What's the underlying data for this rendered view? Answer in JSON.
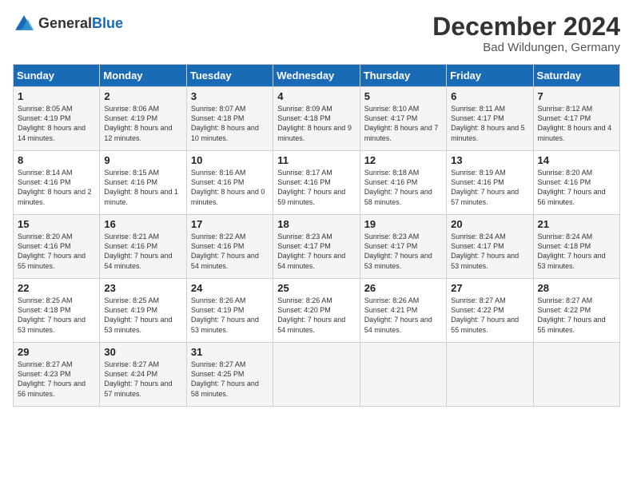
{
  "logo": {
    "general": "General",
    "blue": "Blue"
  },
  "title": "December 2024",
  "subtitle": "Bad Wildungen, Germany",
  "headers": [
    "Sunday",
    "Monday",
    "Tuesday",
    "Wednesday",
    "Thursday",
    "Friday",
    "Saturday"
  ],
  "weeks": [
    [
      {
        "day": "1",
        "sunrise": "8:05 AM",
        "sunset": "4:19 PM",
        "daylight": "8 hours and 14 minutes."
      },
      {
        "day": "2",
        "sunrise": "8:06 AM",
        "sunset": "4:19 PM",
        "daylight": "8 hours and 12 minutes."
      },
      {
        "day": "3",
        "sunrise": "8:07 AM",
        "sunset": "4:18 PM",
        "daylight": "8 hours and 10 minutes."
      },
      {
        "day": "4",
        "sunrise": "8:09 AM",
        "sunset": "4:18 PM",
        "daylight": "8 hours and 9 minutes."
      },
      {
        "day": "5",
        "sunrise": "8:10 AM",
        "sunset": "4:17 PM",
        "daylight": "8 hours and 7 minutes."
      },
      {
        "day": "6",
        "sunrise": "8:11 AM",
        "sunset": "4:17 PM",
        "daylight": "8 hours and 5 minutes."
      },
      {
        "day": "7",
        "sunrise": "8:12 AM",
        "sunset": "4:17 PM",
        "daylight": "8 hours and 4 minutes."
      }
    ],
    [
      {
        "day": "8",
        "sunrise": "8:14 AM",
        "sunset": "4:16 PM",
        "daylight": "8 hours and 2 minutes."
      },
      {
        "day": "9",
        "sunrise": "8:15 AM",
        "sunset": "4:16 PM",
        "daylight": "8 hours and 1 minute."
      },
      {
        "day": "10",
        "sunrise": "8:16 AM",
        "sunset": "4:16 PM",
        "daylight": "8 hours and 0 minutes."
      },
      {
        "day": "11",
        "sunrise": "8:17 AM",
        "sunset": "4:16 PM",
        "daylight": "7 hours and 59 minutes."
      },
      {
        "day": "12",
        "sunrise": "8:18 AM",
        "sunset": "4:16 PM",
        "daylight": "7 hours and 58 minutes."
      },
      {
        "day": "13",
        "sunrise": "8:19 AM",
        "sunset": "4:16 PM",
        "daylight": "7 hours and 57 minutes."
      },
      {
        "day": "14",
        "sunrise": "8:20 AM",
        "sunset": "4:16 PM",
        "daylight": "7 hours and 56 minutes."
      }
    ],
    [
      {
        "day": "15",
        "sunrise": "8:20 AM",
        "sunset": "4:16 PM",
        "daylight": "7 hours and 55 minutes."
      },
      {
        "day": "16",
        "sunrise": "8:21 AM",
        "sunset": "4:16 PM",
        "daylight": "7 hours and 54 minutes."
      },
      {
        "day": "17",
        "sunrise": "8:22 AM",
        "sunset": "4:16 PM",
        "daylight": "7 hours and 54 minutes."
      },
      {
        "day": "18",
        "sunrise": "8:23 AM",
        "sunset": "4:17 PM",
        "daylight": "7 hours and 54 minutes."
      },
      {
        "day": "19",
        "sunrise": "8:23 AM",
        "sunset": "4:17 PM",
        "daylight": "7 hours and 53 minutes."
      },
      {
        "day": "20",
        "sunrise": "8:24 AM",
        "sunset": "4:17 PM",
        "daylight": "7 hours and 53 minutes."
      },
      {
        "day": "21",
        "sunrise": "8:24 AM",
        "sunset": "4:18 PM",
        "daylight": "7 hours and 53 minutes."
      }
    ],
    [
      {
        "day": "22",
        "sunrise": "8:25 AM",
        "sunset": "4:18 PM",
        "daylight": "7 hours and 53 minutes."
      },
      {
        "day": "23",
        "sunrise": "8:25 AM",
        "sunset": "4:19 PM",
        "daylight": "7 hours and 53 minutes."
      },
      {
        "day": "24",
        "sunrise": "8:26 AM",
        "sunset": "4:19 PM",
        "daylight": "7 hours and 53 minutes."
      },
      {
        "day": "25",
        "sunrise": "8:26 AM",
        "sunset": "4:20 PM",
        "daylight": "7 hours and 54 minutes."
      },
      {
        "day": "26",
        "sunrise": "8:26 AM",
        "sunset": "4:21 PM",
        "daylight": "7 hours and 54 minutes."
      },
      {
        "day": "27",
        "sunrise": "8:27 AM",
        "sunset": "4:22 PM",
        "daylight": "7 hours and 55 minutes."
      },
      {
        "day": "28",
        "sunrise": "8:27 AM",
        "sunset": "4:22 PM",
        "daylight": "7 hours and 55 minutes."
      }
    ],
    [
      {
        "day": "29",
        "sunrise": "8:27 AM",
        "sunset": "4:23 PM",
        "daylight": "7 hours and 56 minutes."
      },
      {
        "day": "30",
        "sunrise": "8:27 AM",
        "sunset": "4:24 PM",
        "daylight": "7 hours and 57 minutes."
      },
      {
        "day": "31",
        "sunrise": "8:27 AM",
        "sunset": "4:25 PM",
        "daylight": "7 hours and 58 minutes."
      },
      null,
      null,
      null,
      null
    ]
  ],
  "labels": {
    "sunrise": "Sunrise:",
    "sunset": "Sunset:",
    "daylight": "Daylight hours"
  }
}
